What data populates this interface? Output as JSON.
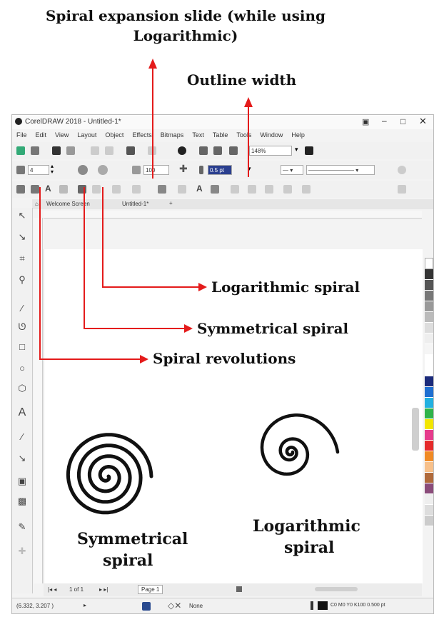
{
  "annotations": {
    "expansion_line1": "Spiral expansion slide (while using",
    "expansion_line2": "Logarithmic)",
    "outline_width": "Outline width",
    "logarithmic": "Logarithmic spiral",
    "symmetrical": "Symmetrical spiral",
    "revolutions": "Spiral revolutions"
  },
  "app": {
    "title": "CorelDRAW 2018 - Untitled-1*",
    "menu": [
      "File",
      "Edit",
      "View",
      "Layout",
      "Object",
      "Effects",
      "Bitmaps",
      "Text",
      "Table",
      "Tools",
      "Window",
      "Help"
    ],
    "zoom": "148%"
  },
  "propertybar": {
    "revolutions": "4",
    "expansion": "100",
    "outline": "0.5 pt"
  },
  "doc_tabs": [
    "Welcome Screen",
    "Untitled-1*"
  ],
  "canvas": {
    "symmetrical_label_1": "Symmetrical",
    "symmetrical_label_2": "spiral",
    "logarithmic_label_1": "Logarithmic",
    "logarithmic_label_2": "spiral"
  },
  "pagenav": {
    "pages": "1 of 1",
    "page_tab": "Page 1"
  },
  "status": {
    "coords": "(6.332, 3.207 )",
    "fill": "None",
    "outline": "C0 M0 Y0 K100  0.500 pt"
  },
  "colors": {
    "arrow": "#e41b1b"
  }
}
